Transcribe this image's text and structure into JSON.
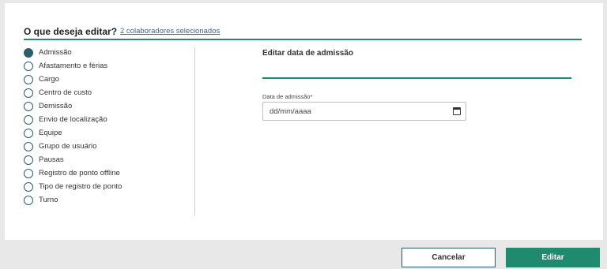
{
  "header": {
    "title": "O que deseja editar?",
    "selection_link": "2 colaboradores selecionados"
  },
  "options": [
    {
      "label": "Admissão",
      "checked": true
    },
    {
      "label": "Afastamento e férias",
      "checked": false
    },
    {
      "label": "Cargo",
      "checked": false
    },
    {
      "label": "Centro de custo",
      "checked": false
    },
    {
      "label": "Demissão",
      "checked": false
    },
    {
      "label": "Envio de localização",
      "checked": false
    },
    {
      "label": "Equipe",
      "checked": false
    },
    {
      "label": "Grupo de usuário",
      "checked": false
    },
    {
      "label": "Pausas",
      "checked": false
    },
    {
      "label": "Registro de ponto offline",
      "checked": false
    },
    {
      "label": "Tipo de registro de ponto",
      "checked": false
    },
    {
      "label": "Turno",
      "checked": false
    }
  ],
  "panel": {
    "title": "Editar data de admissão",
    "field_label": "Data de admissão*",
    "date_placeholder": "dd/mm/aaaa"
  },
  "footer": {
    "cancel_label": "Cancelar",
    "edit_label": "Editar"
  },
  "colors": {
    "accent": "#1f8a6e",
    "radio": "#2b5d6f",
    "link": "#2b6f9a"
  }
}
